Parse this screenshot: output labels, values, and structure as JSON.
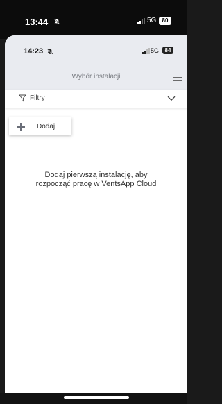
{
  "outer_status": {
    "time": "13:44",
    "network": "5G",
    "battery": "80"
  },
  "inner_status": {
    "time": "14:23",
    "network": "5G",
    "battery": "84"
  },
  "header": {
    "title": "Wybór instalacji"
  },
  "filter": {
    "label": "Filtry"
  },
  "add_button": {
    "label": "Dodaj"
  },
  "empty_state": {
    "line1": "Dodaj pierwszą instalację, aby",
    "line2": "rozpocząć pracę w VentsApp Cloud"
  },
  "icons": {
    "bell": "bell-muted-icon",
    "signal": "signal-icon",
    "menu": "menu-icon",
    "filter": "filter-icon",
    "chevron": "chevron-down-icon",
    "add": "plus-icon"
  }
}
